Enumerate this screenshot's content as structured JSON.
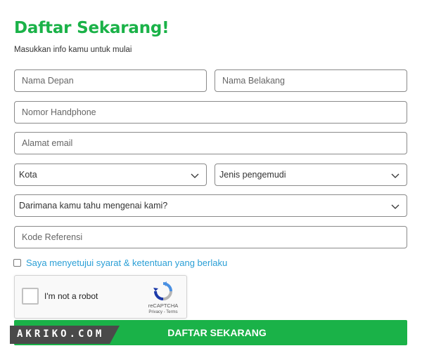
{
  "header": {
    "title": "Daftar Sekarang!",
    "subtitle": "Masukkan info kamu untuk mulai"
  },
  "form": {
    "first_name": {
      "placeholder": "Nama Depan",
      "value": ""
    },
    "last_name": {
      "placeholder": "Nama Belakang",
      "value": ""
    },
    "phone": {
      "placeholder": "Nomor Handphone",
      "value": ""
    },
    "email": {
      "placeholder": "Alamat email",
      "value": ""
    },
    "city": {
      "selected": "Kota"
    },
    "driver_type": {
      "selected": "Jenis pengemudi"
    },
    "source": {
      "selected": "Darimana kamu tahu mengenai kami?"
    },
    "referral": {
      "placeholder": "Kode Referensi",
      "value": ""
    },
    "terms_label": "Saya menyetujui syarat & ketentuan yang berlaku",
    "terms_checked": false
  },
  "recaptcha": {
    "label": "I'm not a robot",
    "brand": "reCAPTCHA",
    "links": "Privacy - Terms"
  },
  "submit": {
    "label": "DAFTAR SEKARANG"
  },
  "watermark": {
    "text": "AKRIKO.COM"
  },
  "colors": {
    "brand_green": "#1ab248",
    "link_blue": "#2a9fd6",
    "border": "#8a8a8a",
    "watermark_bg": "#4a4a4a"
  },
  "icons": [
    "chevron-down-icon",
    "recaptcha-logo-icon"
  ]
}
